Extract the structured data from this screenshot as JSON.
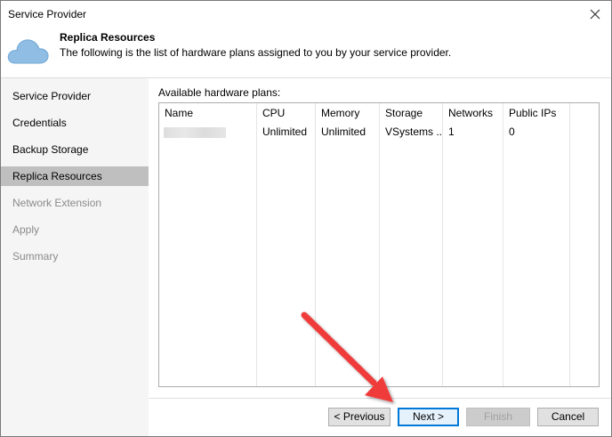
{
  "window": {
    "title": "Service Provider"
  },
  "header": {
    "title": "Replica Resources",
    "subtitle": "The following is the list of hardware plans assigned to you by your service provider."
  },
  "sidebar": {
    "items": [
      {
        "label": "Service Provider",
        "state": "normal"
      },
      {
        "label": "Credentials",
        "state": "normal"
      },
      {
        "label": "Backup Storage",
        "state": "normal"
      },
      {
        "label": "Replica Resources",
        "state": "active"
      },
      {
        "label": "Network Extension",
        "state": "disabled"
      },
      {
        "label": "Apply",
        "state": "disabled"
      },
      {
        "label": "Summary",
        "state": "disabled"
      }
    ]
  },
  "main": {
    "list_label": "Available hardware plans:",
    "columns": [
      "Name",
      "CPU",
      "Memory",
      "Storage",
      "Networks",
      "Public IPs"
    ],
    "rows": [
      {
        "name": "",
        "cpu": "Unlimited",
        "memory": "Unlimited",
        "storage": "VSystems ...",
        "networks": "1",
        "public_ips": "0"
      }
    ]
  },
  "buttons": {
    "previous": "< Previous",
    "next": "Next >",
    "finish": "Finish",
    "cancel": "Cancel"
  },
  "colors": {
    "arrow": "#f03a3a",
    "active_item": "#bfbfbf",
    "sidebar_bg": "#f5f5f5",
    "cloud": "#8fbde3"
  },
  "icons": {
    "header": "cloud-icon",
    "close": "close-icon"
  }
}
